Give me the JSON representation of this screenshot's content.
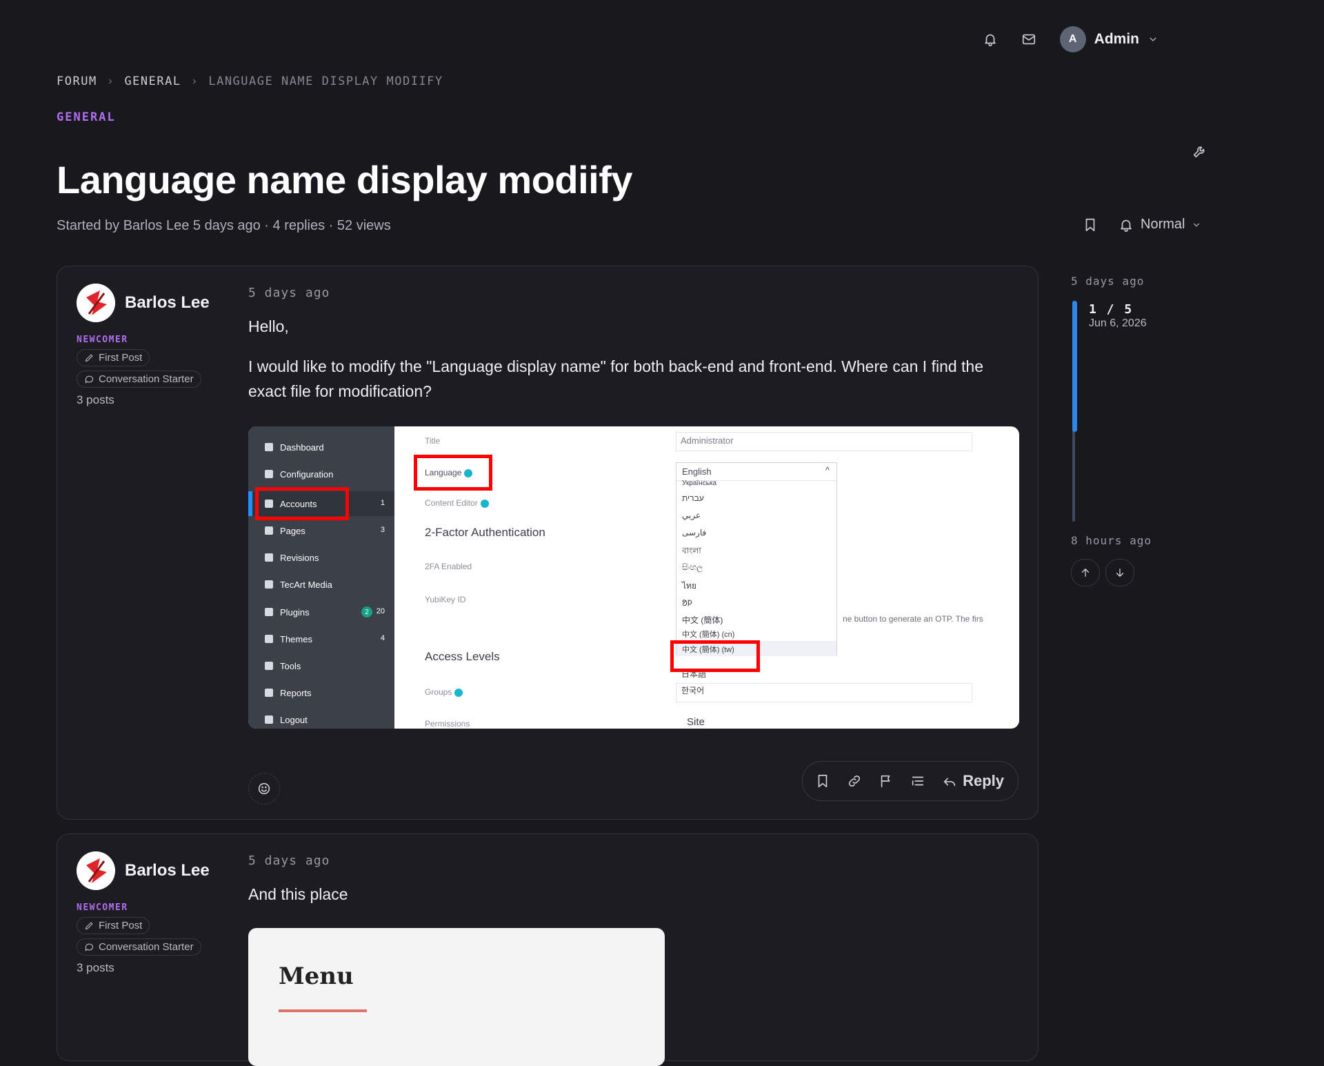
{
  "topbar": {
    "user_initial": "A",
    "user_name": "Admin"
  },
  "breadcrumb": [
    "FORUM",
    "GENERAL",
    "LANGUAGE NAME DISPLAY MODIIFY"
  ],
  "category": "GENERAL",
  "thread": {
    "title": "Language name display modiify",
    "meta": "Started by Barlos Lee 5 days ago · 4 replies · 52 views",
    "subscription": "Normal"
  },
  "timeline": {
    "start": "5 days ago",
    "position": "1 / 5",
    "date": "Jun 6, 2026",
    "end": "8 hours ago"
  },
  "posts": [
    {
      "author": "Barlos Lee",
      "rank": "NEWCOMER",
      "badges": [
        "First Post",
        "Conversation Starter"
      ],
      "post_count": "3 posts",
      "time": "5 days ago",
      "paragraphs": [
        "Hello,",
        "I would like to modify the \"Language display name\" for both back-end and front-end. Where can I find the exact file for modification?"
      ],
      "reply_label": "Reply"
    },
    {
      "author": "Barlos Lee",
      "rank": "NEWCOMER",
      "badges": [
        "First Post",
        "Conversation Starter"
      ],
      "post_count": "3 posts",
      "time": "5 days ago",
      "paragraphs": [
        "And this place"
      ]
    }
  ],
  "screenshot": {
    "sidebar": [
      {
        "label": "Dashboard",
        "count": ""
      },
      {
        "label": "Configuration",
        "count": ""
      },
      {
        "label": "Accounts",
        "count": "1"
      },
      {
        "label": "Pages",
        "count": "3"
      },
      {
        "label": "Revisions",
        "count": ""
      },
      {
        "label": "TecArt Media",
        "count": ""
      },
      {
        "label": "Plugins",
        "count": "20",
        "pill": "2"
      },
      {
        "label": "Themes",
        "count": "4"
      },
      {
        "label": "Tools",
        "count": ""
      },
      {
        "label": "Reports",
        "count": ""
      },
      {
        "label": "Logout",
        "count": ""
      }
    ],
    "labels": {
      "title": "Title",
      "title_value": "Administrator",
      "language": "Language",
      "content_editor": "Content Editor",
      "twofa_heading": "2-Factor Authentication",
      "twofa_enabled": "2FA Enabled",
      "yubikey": "YubiKey ID",
      "access_levels": "Access Levels",
      "groups": "Groups",
      "permissions": "Permissions",
      "site": "Site",
      "otp_note": "ne button to generate an OTP. The firs"
    },
    "dropdown": {
      "selected": "English",
      "options": [
        "Українська",
        "עברית",
        "عربي",
        "فارسی",
        "বাংলা",
        "සිංහල",
        "ไทย",
        "ᱚᱞ",
        "中文 (簡体)",
        "中文 (簡体) (cn)",
        "中文 (簡体) (tw)",
        "日本語",
        "한국어"
      ]
    }
  },
  "menu_image": {
    "title": "Menu"
  },
  "colors": {
    "accent": "#b06ff0",
    "background": "#19181d",
    "timeline": "#2f87e8"
  }
}
